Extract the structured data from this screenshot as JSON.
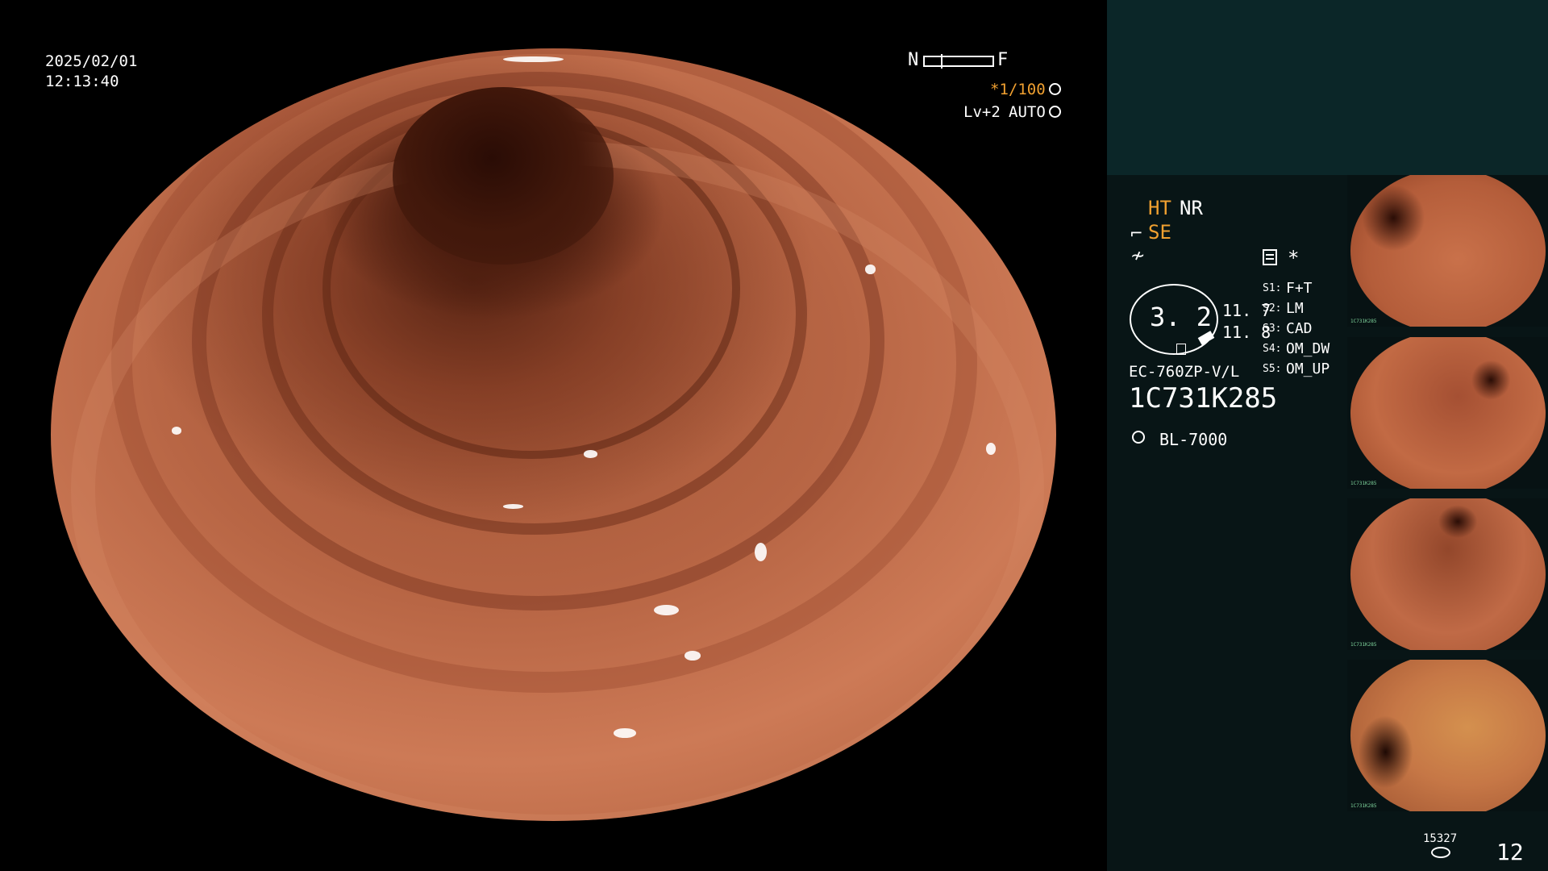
{
  "header": {
    "date": "2025/02/01",
    "time": "12:13:40"
  },
  "overlay": {
    "near_label": "N",
    "far_label": "F",
    "shutter": "*1/100",
    "level": "Lv+2",
    "auto": "AUTO"
  },
  "settings": {
    "ht": "HT",
    "nr": "NR",
    "se": "SE",
    "asterisk": "*",
    "dial_value": "3. 2",
    "val_a": "11. 7",
    "val_b": "11. 8",
    "scope_model": "EC-760ZP-V/L",
    "serial": "1C731K285",
    "light_source": "BL-7000"
  },
  "switches": [
    {
      "key": "S1:",
      "value": "F+T"
    },
    {
      "key": "S2:",
      "value": "LM"
    },
    {
      "key": "S3:",
      "value": "CAD"
    },
    {
      "key": "S4:",
      "value": "OM_DW"
    },
    {
      "key": "S5:",
      "value": "OM_UP"
    }
  ],
  "thumbnails": [
    {
      "label": "1C731K285"
    },
    {
      "label": "1C731K285"
    },
    {
      "label": "1C731K285"
    },
    {
      "label": "1C731K285"
    }
  ],
  "footer": {
    "capture_count": "15327",
    "page_number": "12"
  },
  "icons": [
    "shutter-mode-icon",
    "auto-mode-icon",
    "se-icon",
    "fan-icon",
    "memory-icon",
    "lamp-icon",
    "disk-icon"
  ],
  "colors": {
    "accent": "#f0a030",
    "panel_top": "#0b2628",
    "panel_bottom": "#081516"
  }
}
